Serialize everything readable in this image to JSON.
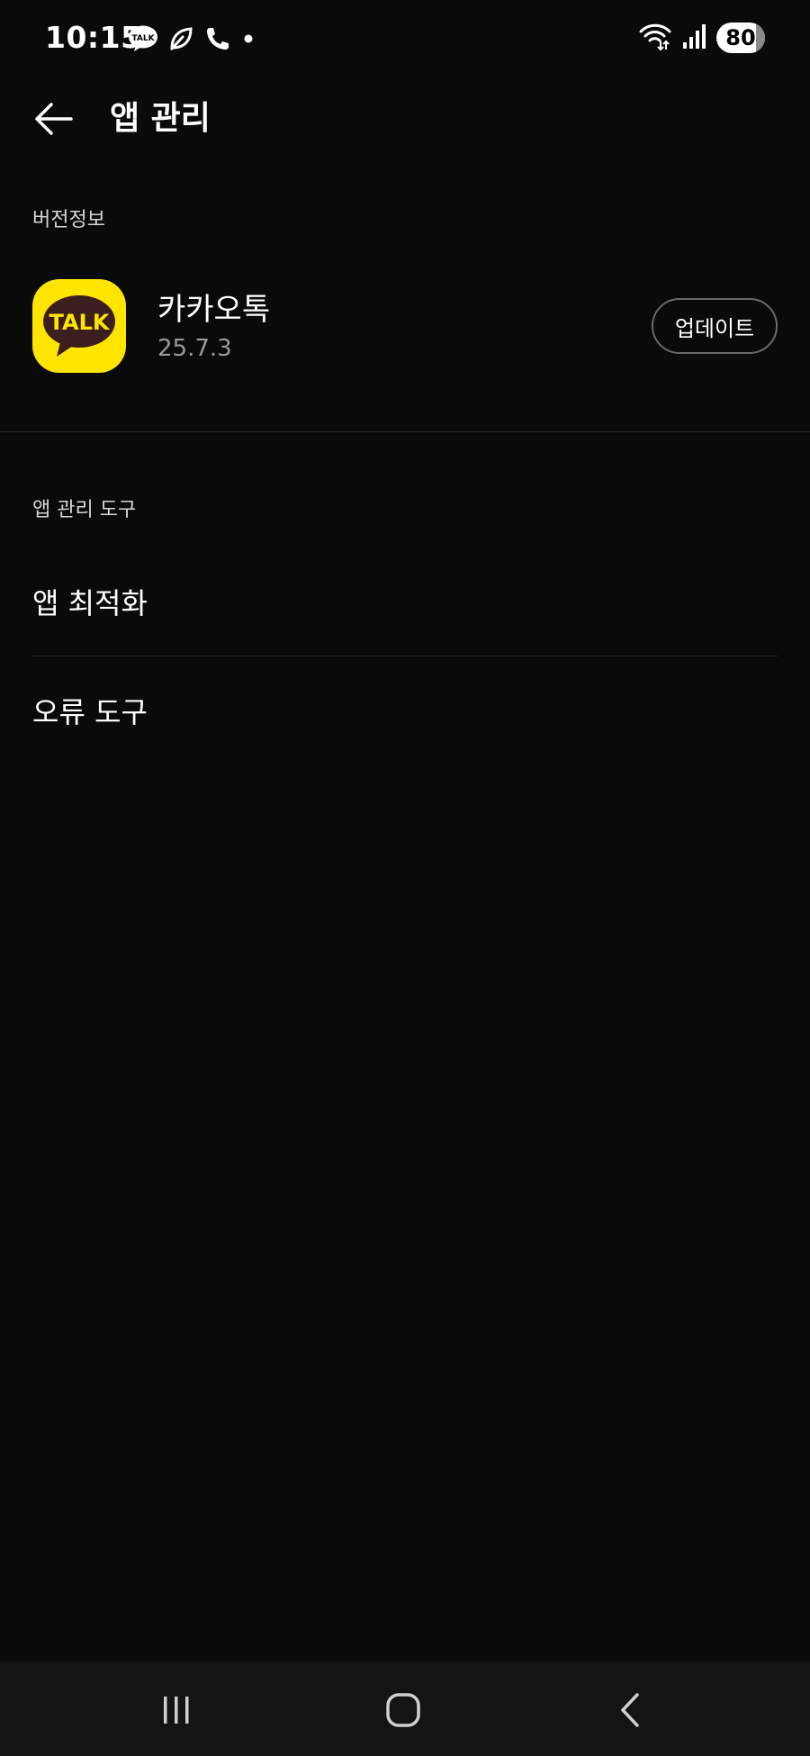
{
  "status_bar": {
    "time": "10:15",
    "battery": "80",
    "left_icons": [
      "kakaotalk-icon",
      "leaf-icon",
      "phone-icon",
      "dot-icon"
    ],
    "right_icons": [
      "wifi-icon",
      "signal-icon",
      "battery-icon"
    ]
  },
  "header": {
    "title": "앱 관리",
    "back_icon": "back-arrow-icon"
  },
  "version_section": {
    "label": "버전정보",
    "app": {
      "icon_text": "TALK",
      "name": "카카오톡",
      "version": "25.7.3",
      "update_label": "업데이트"
    }
  },
  "tools_section": {
    "label": "앱 관리 도구",
    "items": [
      {
        "label": "앱 최적화"
      },
      {
        "label": "오류 도구"
      }
    ]
  },
  "nav_bar": {
    "icons": [
      "recents-icon",
      "home-icon",
      "back-icon"
    ]
  },
  "colors": {
    "background": "#0a0a0a",
    "kakao_yellow": "#fee500",
    "kakao_brown": "#3c1e1e",
    "secondary_text": "#9a9a9a"
  }
}
